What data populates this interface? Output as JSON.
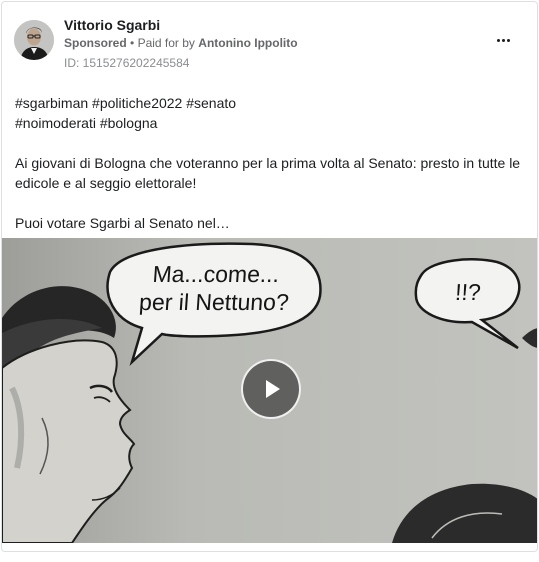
{
  "post": {
    "page_name": "Vittorio Sgarbi",
    "sponsored_label": "Sponsored",
    "separator": "•",
    "paid_for_prefix": "Paid for by",
    "paid_for_name": "Antonino Ippolito",
    "ad_id": "ID: 1515276202245584",
    "more_icon": "more-horizontal-icon",
    "hashtags_line1": "#sgarbiman #politiche2022 #senato",
    "hashtags_line2": "#noimoderati #bologna",
    "paragraph1": "Ai giovani di Bologna che voteranno per la prima volta al Senato: presto in tutte le edicole e al seggio elettorale!",
    "paragraph2": "Puoi votare Sgarbi al Senato nel…"
  },
  "video": {
    "bubble_left_line1": "Ma...come...",
    "bubble_left_line2": "per il Nettuno?",
    "bubble_right": "!!?",
    "play_icon": "play-icon"
  },
  "colors": {
    "text_primary": "#1c1e21",
    "text_secondary": "#65676b",
    "border": "#dddfe2",
    "video_background": "#b7b8b3"
  }
}
